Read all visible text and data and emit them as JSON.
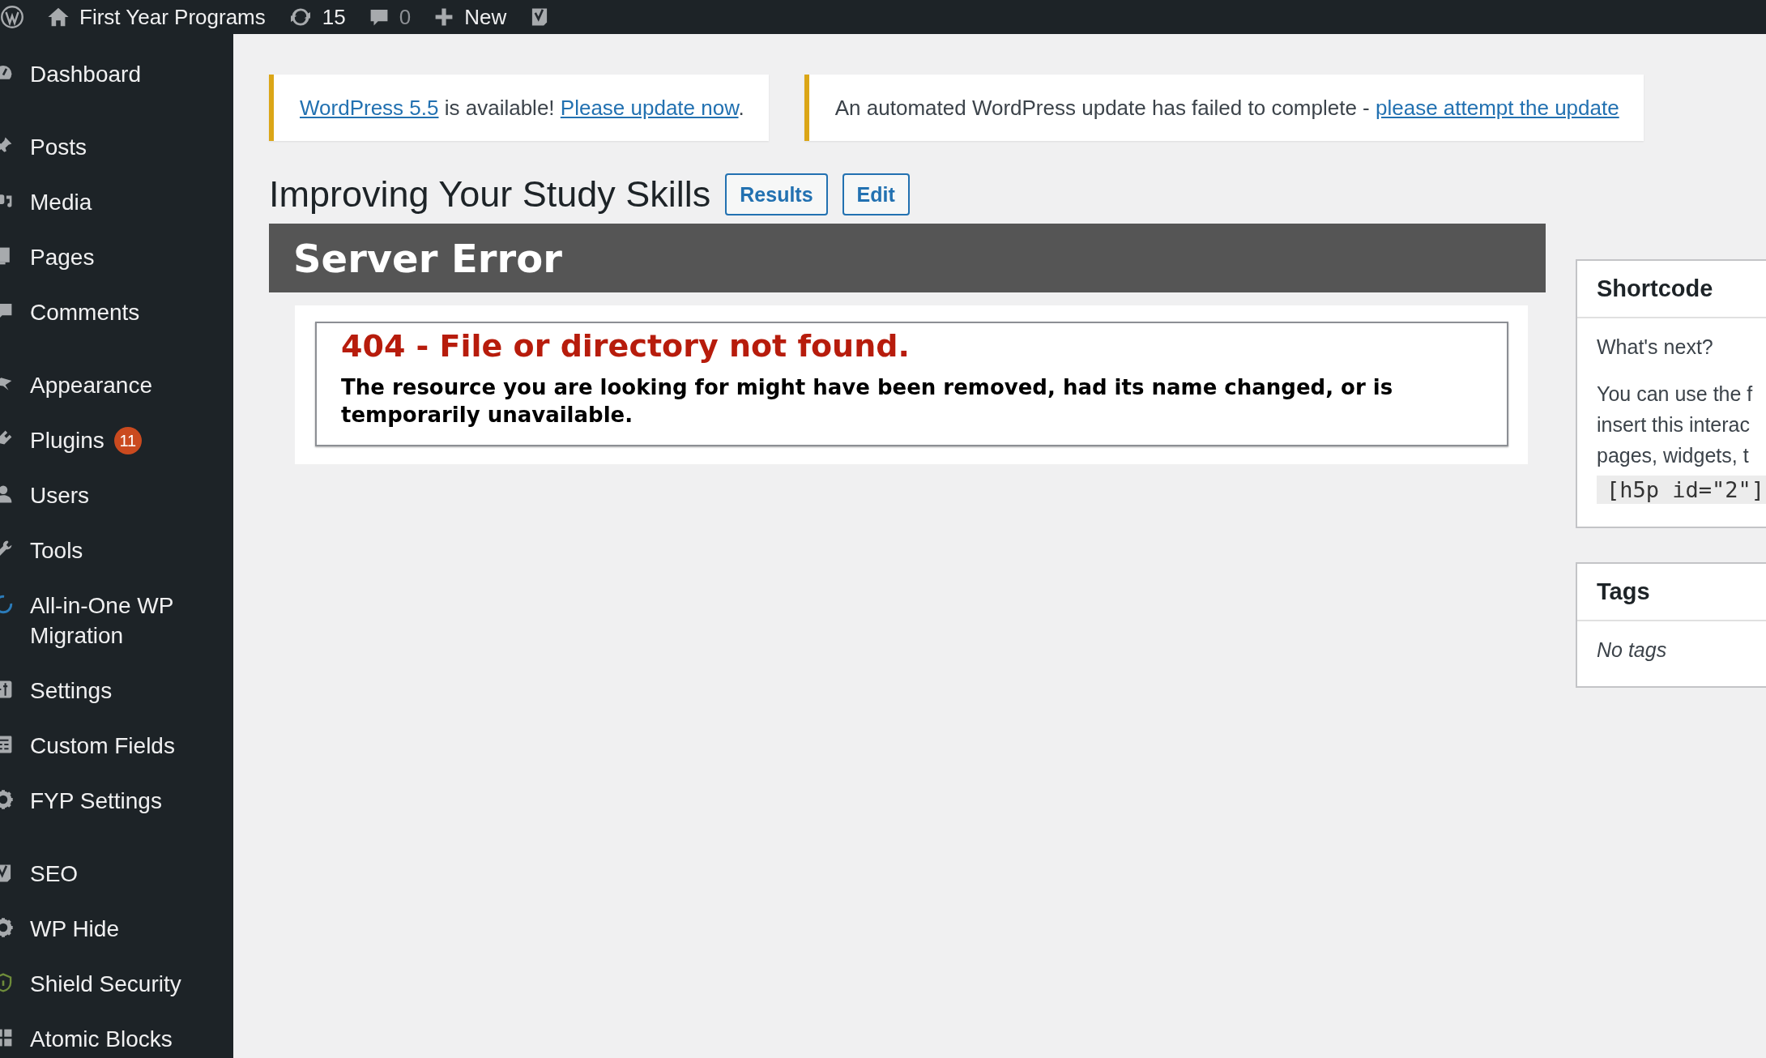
{
  "admin_bar": {
    "items": [
      {
        "kind": "logo"
      },
      {
        "kind": "home",
        "label": "First Year Programs"
      },
      {
        "kind": "updates",
        "label": "15"
      },
      {
        "kind": "comments",
        "label": "0"
      },
      {
        "kind": "new",
        "label": "New"
      },
      {
        "kind": "seo"
      }
    ]
  },
  "sidebar": {
    "groups": [
      [
        {
          "kind": "dashboard",
          "label": "Dashboard"
        }
      ],
      [
        {
          "kind": "posts",
          "label": "Posts"
        },
        {
          "kind": "media",
          "label": "Media"
        },
        {
          "kind": "pages",
          "label": "Pages"
        },
        {
          "kind": "comments",
          "label": "Comments"
        }
      ],
      [
        {
          "kind": "appearance",
          "label": "Appearance"
        },
        {
          "kind": "plugins",
          "label": "Plugins",
          "badge": "11"
        },
        {
          "kind": "users",
          "label": "Users"
        },
        {
          "kind": "tools",
          "label": "Tools"
        },
        {
          "kind": "migration",
          "label": "All-in-One WP Migration"
        },
        {
          "kind": "settings",
          "label": "Settings"
        },
        {
          "kind": "fields",
          "label": "Custom Fields"
        },
        {
          "kind": "gear",
          "label": "FYP Settings"
        }
      ],
      [
        {
          "kind": "seo",
          "label": "SEO"
        },
        {
          "kind": "gear",
          "label": "WP Hide"
        },
        {
          "kind": "shield",
          "label": "Shield Security"
        },
        {
          "kind": "blocks",
          "label": "Atomic Blocks"
        }
      ]
    ]
  },
  "notices": [
    {
      "parts": [
        {
          "kind": "link",
          "text": "WordPress 5.5"
        },
        {
          "kind": "text",
          "text": " is available! "
        },
        {
          "kind": "link",
          "text": "Please update now"
        },
        {
          "kind": "text",
          "text": "."
        }
      ]
    },
    {
      "parts": [
        {
          "kind": "text",
          "text": "An automated WordPress update has failed to complete - "
        },
        {
          "kind": "link",
          "text": "please attempt the update"
        }
      ]
    }
  ],
  "page": {
    "title": "Improving Your Study Skills",
    "buttons": [
      "Results",
      "Edit"
    ]
  },
  "content": {
    "banner": "Server Error",
    "error_title": "404 - File or directory not found.",
    "error_message": "The resource you are looking for might have been removed, had its name changed, or is temporarily unavailable."
  },
  "side_boxes": [
    {
      "title": "Shortcode",
      "lead": "What's next?",
      "lines": [
        "You can use the f",
        "insert this interac",
        "pages, widgets, t"
      ],
      "code": "[h5p id=\"2\"]"
    },
    {
      "title": "Tags",
      "empty": "No tags"
    }
  ]
}
